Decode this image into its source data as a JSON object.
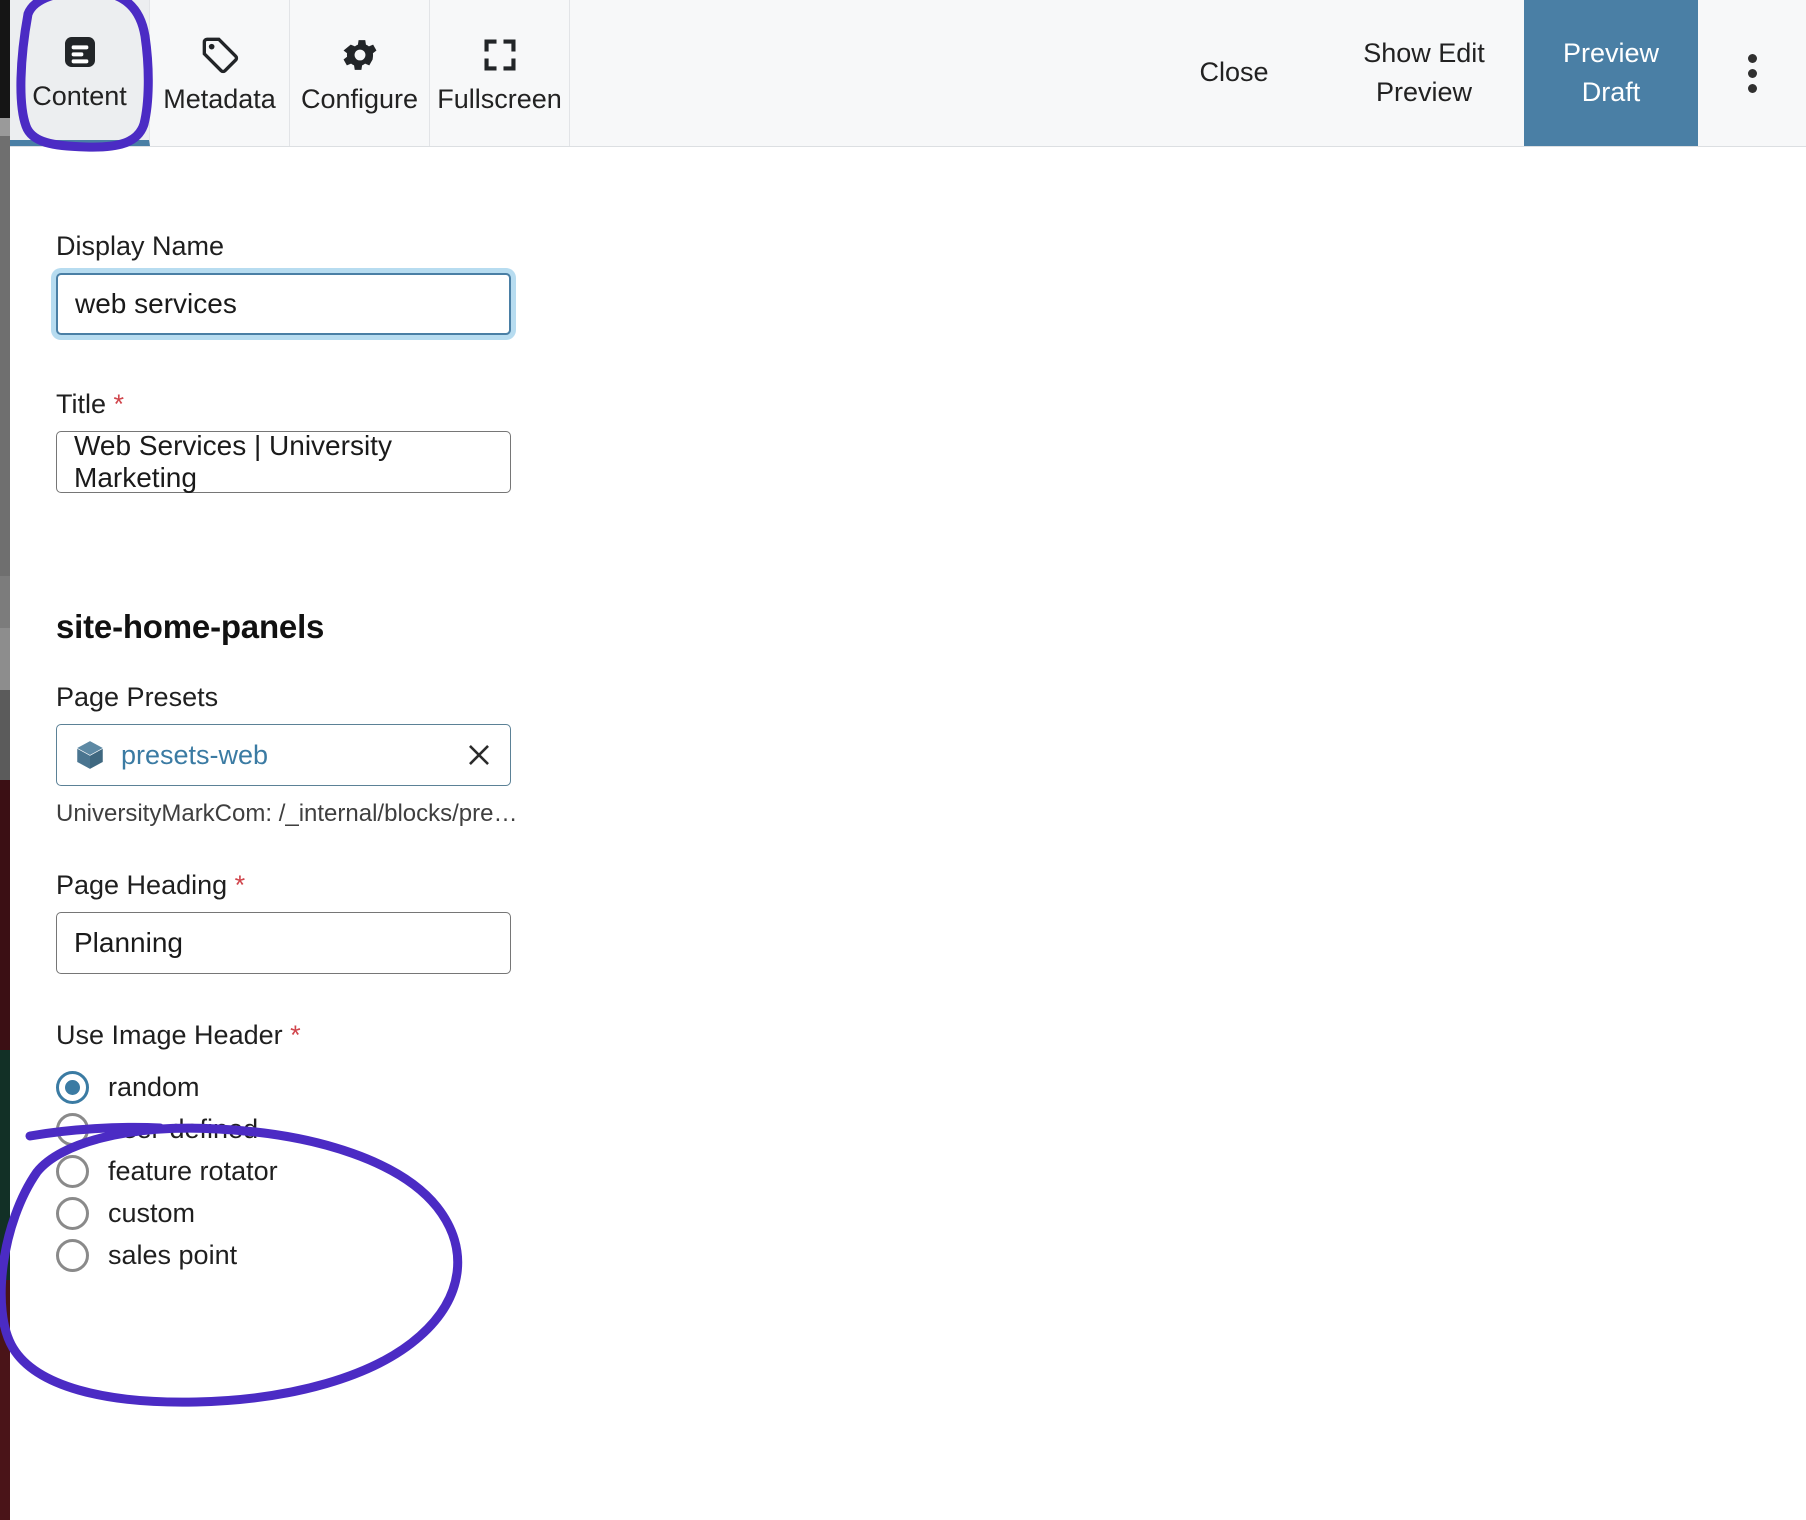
{
  "app": {
    "accent_blue": "#4a7fa5",
    "link_blue": "#3b7ba3",
    "required_red": "#d0454c",
    "annotation_purple": "#4b2bc4"
  },
  "toolbar": {
    "tabs": [
      {
        "label": "Content",
        "icon": "document-lines-icon",
        "active": true
      },
      {
        "label": "Metadata",
        "icon": "tag-icon",
        "active": false
      },
      {
        "label": "Configure",
        "icon": "gear-icon",
        "active": false
      },
      {
        "label": "Fullscreen",
        "icon": "fullscreen-icon",
        "active": false
      }
    ],
    "close_label": "Close",
    "show_edit_preview_label": "Show Edit Preview",
    "preview_draft_label": "Preview Draft",
    "kebab_icon": "more-vertical-icon"
  },
  "form": {
    "display_name": {
      "label": "Display Name",
      "value": "web services",
      "required": false,
      "focused": true
    },
    "title": {
      "label": "Title",
      "value": "Web Services | University Marketing",
      "required": true,
      "required_marker": "*"
    },
    "section_heading": "site-home-panels",
    "page_presets": {
      "label": "Page Presets",
      "chip_label": "presets-web",
      "chip_icon": "cube-icon",
      "clear_icon": "close-icon",
      "helper_text": "UniversityMarkCom: /_internal/blocks/preset..."
    },
    "page_heading": {
      "label": "Page Heading",
      "value": "Planning",
      "required": true,
      "required_marker": "*"
    },
    "use_image_header": {
      "label": "Use Image Header",
      "required": true,
      "required_marker": "*",
      "selected": "random",
      "options": [
        {
          "label": "random",
          "checked": true
        },
        {
          "label": "user-defined",
          "checked": false
        },
        {
          "label": "feature rotator",
          "checked": false
        },
        {
          "label": "custom",
          "checked": false
        },
        {
          "label": "sales point",
          "checked": false
        }
      ]
    }
  },
  "annotations": [
    {
      "name": "circle-around-content-tab",
      "shape": "hand-drawn-ellipse"
    },
    {
      "name": "circle-around-use-image-header-options",
      "shape": "hand-drawn-ellipse"
    }
  ]
}
